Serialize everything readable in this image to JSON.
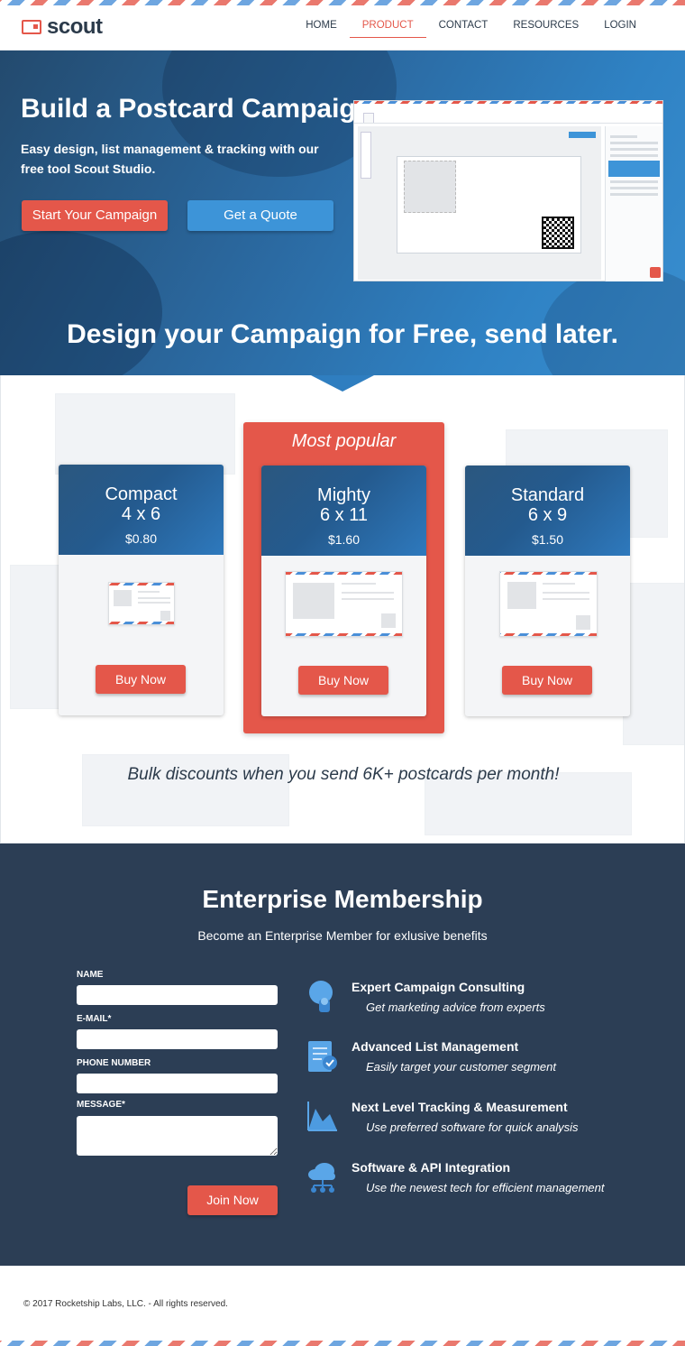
{
  "brand": {
    "name": "scout",
    "colors": {
      "accent": "#e4574a",
      "blue": "#3d94d8",
      "navy": "#2c3e55"
    }
  },
  "nav": {
    "items": [
      {
        "label": "HOME",
        "active": false
      },
      {
        "label": "PRODUCT",
        "active": true
      },
      {
        "label": "CONTACT",
        "active": false
      },
      {
        "label": "RESOURCES",
        "active": false
      },
      {
        "label": "LOGIN",
        "active": false
      }
    ]
  },
  "hero": {
    "title": "Build a Postcard Campaign",
    "subtitle": "Easy design, list management & tracking with our free tool Scout Studio.",
    "primary_button": "Start Your Campaign",
    "secondary_button": "Get a Quote",
    "tagline": "Design your Campaign for Free, send later."
  },
  "pricing": {
    "popular_label": "Most popular",
    "plans": [
      {
        "name": "Compact",
        "size": "4 x 6",
        "price": "$0.80",
        "button": "Buy Now"
      },
      {
        "name": "Mighty",
        "size": "6 x 11",
        "price": "$1.60",
        "button": "Buy Now"
      },
      {
        "name": "Standard",
        "size": "6 x 9",
        "price": "$1.50",
        "button": "Buy Now"
      }
    ],
    "bulk_note": "Bulk discounts when you send 6K+ postcards per month!"
  },
  "enterprise": {
    "title": "Enterprise Membership",
    "subtitle": "Become an Enterprise Member for exlusive benefits",
    "form": {
      "name_label": "NAME",
      "email_label": "E-MAIL*",
      "phone_label": "PHONE NUMBER",
      "message_label": "MESSAGE*",
      "submit": "Join Now"
    },
    "features": [
      {
        "icon": "consulting-head-icon",
        "title": "Expert Campaign Consulting",
        "desc": "Get marketing advice from experts"
      },
      {
        "icon": "list-check-icon",
        "title": "Advanced List Management",
        "desc": "Easily target your customer segment"
      },
      {
        "icon": "area-chart-icon",
        "title": "Next Level Tracking & Measurement",
        "desc": "Use preferred software for quick analysis"
      },
      {
        "icon": "cloud-network-icon",
        "title": "Software & API Integration",
        "desc": "Use the newest tech for efficient management"
      }
    ]
  },
  "footer": {
    "copyright": "© 2017 Rocketship Labs, LLC. - All rights reserved."
  }
}
